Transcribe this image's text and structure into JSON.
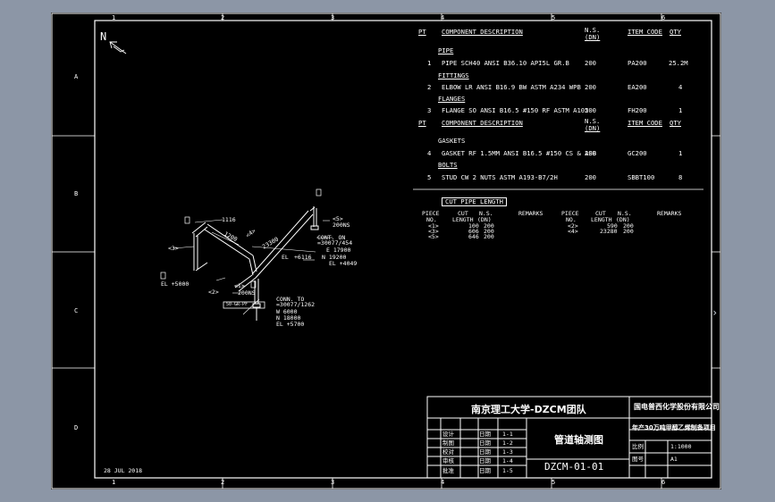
{
  "zones": {
    "top": [
      "1",
      "2",
      "3",
      "4",
      "5",
      "6"
    ],
    "bottom": [
      "1",
      "2",
      "3",
      "4",
      "5",
      "6"
    ],
    "side": [
      "A",
      "B",
      "C",
      "D"
    ]
  },
  "north": "N",
  "bom": {
    "header1": {
      "pt": "PT",
      "desc": "COMPONENT DESCRIPTION",
      "ns1": "N.S.",
      "ns2": "(DN)",
      "item": "ITEM CODE",
      "qty": "QTY"
    },
    "header2": {
      "pt": "PT",
      "desc": "COMPONENT DESCRIPTION",
      "ns1": "N.S.",
      "ns2": "(DN)",
      "item": "ITEM CODE",
      "qty": "QTY"
    },
    "groups": {
      "pipe": "PIPE",
      "fittings": "FITTINGS",
      "flanges": "FLANGES",
      "gaskets": "GASKETS",
      "bolts": "BOLTS"
    },
    "rows": [
      {
        "pt": "1",
        "desc": "PIPE SCH40 ANSI B36.10 API5L GR.B",
        "ns": "200",
        "item": "PA200",
        "qty": "25.2M"
      },
      {
        "pt": "2",
        "desc": "ELBOW LR ANSI B16.9 BW ASTM A234 WPB",
        "ns": "200",
        "item": "EA200",
        "qty": "4"
      },
      {
        "pt": "3",
        "desc": "FLANGE SO ANSI B16.5 #150 RF ASTM A105",
        "ns": "200",
        "item": "FH200",
        "qty": "1"
      },
      {
        "pt": "4",
        "desc": "GASKET RF 1.5MM ANSI B16.5 #150 CS & ASB",
        "ns": "200",
        "item": "GC200",
        "qty": "1"
      },
      {
        "pt": "5",
        "desc": "STUD CW 2 NUTS ASTM A193-B7/2H",
        "ns": "200",
        "item": "SBBT100",
        "qty": "8"
      }
    ]
  },
  "cut": {
    "title": "CUT PIPE LENGTH",
    "h_piece1": "PIECE",
    "h_no1": "NO.",
    "h_cut1": "CUT",
    "h_len1": "LENGTH",
    "h_ns1": "N.S.",
    "h_dn1": "(DN)",
    "h_rem1": "REMARKS",
    "h_piece2": "PIECE",
    "h_no2": "NO.",
    "h_cut2": "CUT",
    "h_len2": "LENGTH",
    "h_ns2": "N.S.",
    "h_dn2": "(DN)",
    "h_rem2": "REMARKS",
    "left": [
      {
        "no": "<1>",
        "len": "100",
        "ns": "200"
      },
      {
        "no": "<3>",
        "len": "606",
        "ns": "200"
      },
      {
        "no": "<5>",
        "len": "646",
        "ns": "200"
      }
    ],
    "right": [
      {
        "no": "<2>",
        "len": "590",
        "ns": "200"
      },
      {
        "no": "<4>",
        "len": "23280",
        "ns": "200"
      }
    ]
  },
  "iso": {
    "d1116": "1116",
    "d1200": "1200",
    "d23300": "23300",
    "d4": "<4>",
    "d3": "<3>",
    "d5": "<5>",
    "d2": "<2>",
    "d1": "<1>",
    "ns200a": "200NS",
    "ns200b": "200NS",
    "cont_on": "CONT. ON",
    "cont_on_ref": "=30077/454",
    "e17900": "E 17900",
    "n19200": "N 19200",
    "el4049": "EL +4049",
    "el6116": "+6116",
    "el_lbl": "EL",
    "el5000": "EL +5000",
    "el_lbl2": "EL",
    "conn_to": "CONN. TO",
    "conn_ref": "=30077/1262",
    "w6000": "W 6000",
    "n18000": "N 18000",
    "el5700": "EL +5700",
    "tag": "50-GR-PF"
  },
  "title_block": {
    "school": "南京理工大学-DZCM团队",
    "company": "国电普西化学股份有限公司",
    "project": "年产30万吨甲醇乙烯制备项目",
    "drawing_title": "管道轴测图",
    "drawing_no": "DZCM-01-01",
    "scale_label": "比例",
    "scale_value": "1:1000",
    "sheet_label": "图号",
    "sheet_value": "A1",
    "rows": [
      [
        "设计",
        "",
        "日期",
        "1-1"
      ],
      [
        "制图",
        "",
        "日期",
        "1-2"
      ],
      [
        "校对",
        "",
        "日期",
        "1-3"
      ],
      [
        "审核",
        "",
        "日期",
        "1-4"
      ],
      [
        "批准",
        "",
        "日期",
        "1-5"
      ]
    ]
  },
  "date": "28 JUL 2018"
}
